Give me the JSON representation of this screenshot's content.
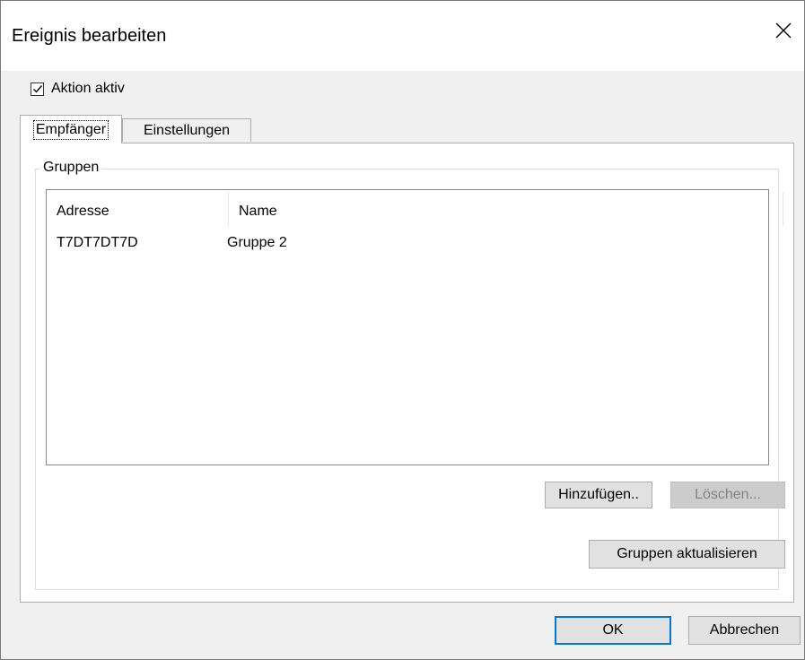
{
  "window": {
    "title": "Ereignis bearbeiten",
    "close_icon": "close-icon"
  },
  "action_active": {
    "label": "Aktion aktiv",
    "checked": true
  },
  "tabs": [
    {
      "label": "Empfänger",
      "active": true
    },
    {
      "label": "Einstellungen",
      "active": false
    }
  ],
  "groups": {
    "legend": "Gruppen",
    "columns": [
      "Adresse",
      "Name"
    ],
    "rows": [
      {
        "address": "T7DT7DT7D",
        "name": "Gruppe 2"
      }
    ],
    "add_button": "Hinzufügen..",
    "delete_button": "Löschen...",
    "refresh_button": "Gruppen aktualisieren"
  },
  "footer": {
    "ok_button": "OK",
    "cancel_button": "Abbrechen"
  },
  "colors": {
    "accent": "#0078d7",
    "dialog_bg": "#f0f0f0",
    "button_bg": "#e1e1e1",
    "disabled_text": "#838383"
  }
}
